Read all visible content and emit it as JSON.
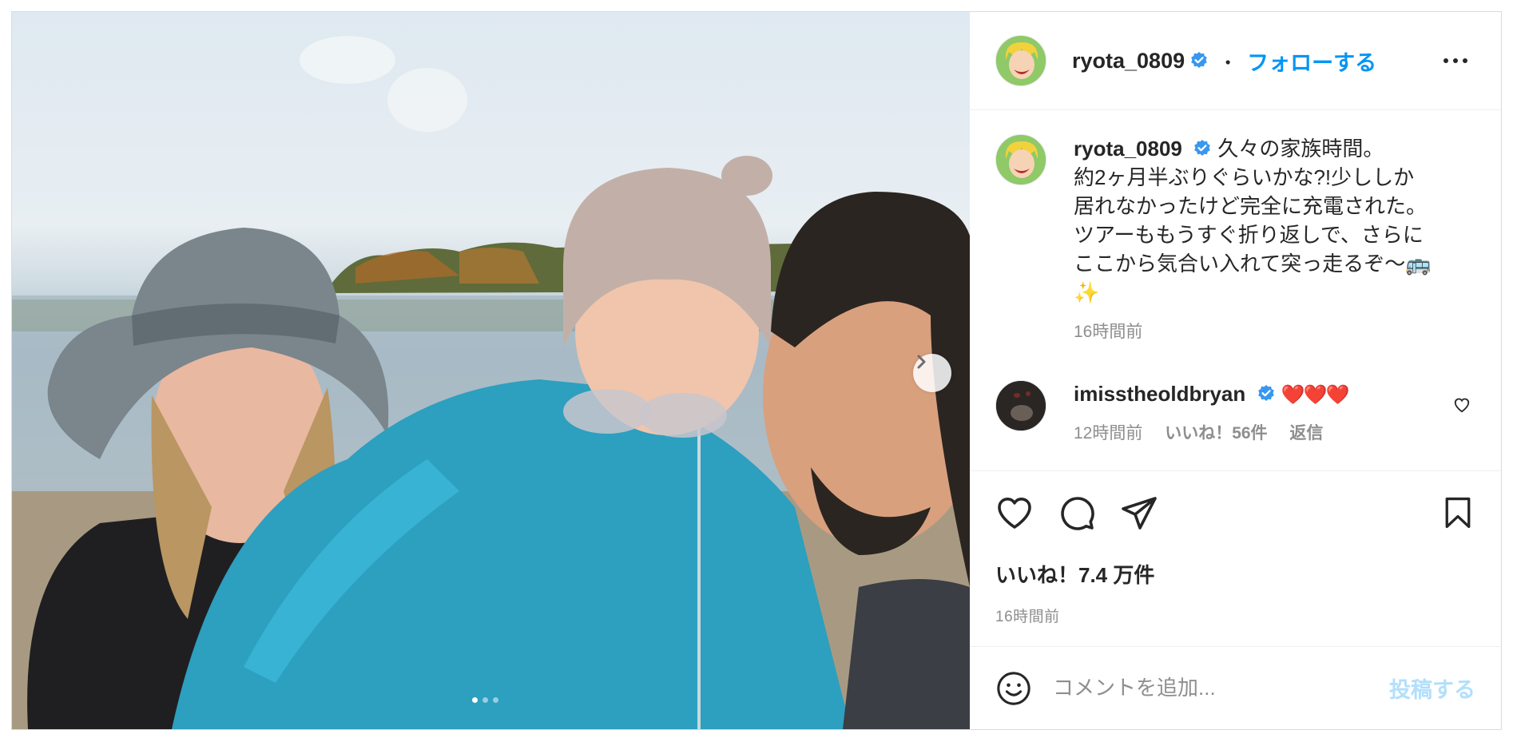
{
  "post": {
    "username": "ryota_0809",
    "follow_label": "フォローする",
    "separator": "・",
    "caption_lines": [
      "久々の家族時間。",
      "約2ヶ月半ぶりぐらいかな?!少ししか",
      "居れなかったけど完全に充電された。",
      "ツアーももうすぐ折り返しで、さらに",
      "ここから気合い入れて突っ走るぞ〜🚌",
      "✨"
    ],
    "caption_time": "16時間前",
    "comment": {
      "username": "imisstheoldbryan",
      "text": "❤️❤️❤️",
      "time": "12時間前",
      "likes": "いいね！56件",
      "reply_label": "返信"
    },
    "likes": "いいね！7.4 万件",
    "time": "16時間前",
    "composer": {
      "placeholder": "コメントを追加...",
      "post_label": "投稿する"
    },
    "carousel": {
      "total": 3,
      "active": 1
    }
  },
  "colors": {
    "accent": "#0095f6",
    "post_disabled": "#b2dffc",
    "heart": "#ed4956",
    "verified": "#3897f0"
  },
  "icons": [
    "verified-badge-icon",
    "more-options-icon",
    "chevron-right-icon",
    "heart-icon",
    "comment-icon",
    "share-icon",
    "bookmark-icon",
    "emoji-icon"
  ]
}
